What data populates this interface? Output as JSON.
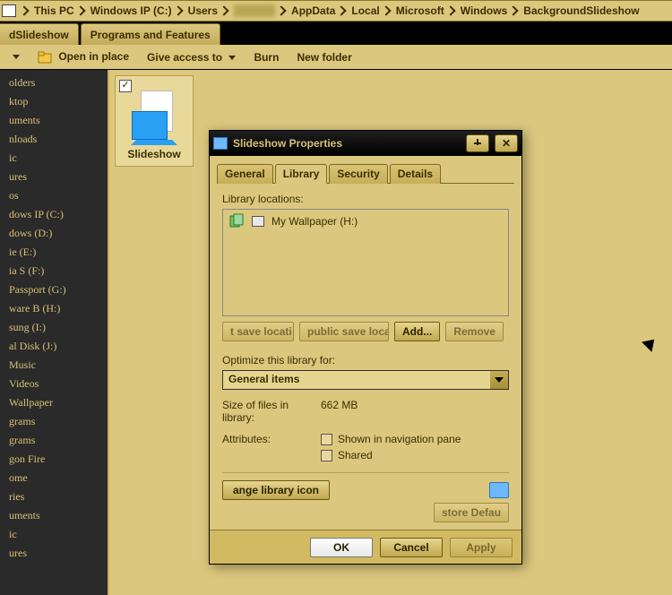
{
  "breadcrumb": [
    "This PC",
    "Windows IP (C:)",
    "Users",
    "",
    "AppData",
    "Local",
    "Microsoft",
    "Windows",
    "BackgroundSlideshow"
  ],
  "file_tabs": {
    "left_partial": "dSlideshow",
    "right": "Programs and Features"
  },
  "toolbar": {
    "open": "Open in place",
    "give_access": "Give access to",
    "burn": "Burn",
    "new_folder": "New folder"
  },
  "sidebar": [
    "olders",
    "ktop",
    "uments",
    "nloads",
    "ic",
    "ures",
    "os",
    "dows IP (C:)",
    "dows (D:)",
    "ie (E:)",
    "ia S (F:)",
    "Passport (G:)",
    "ware B (H:)",
    "sung (I:)",
    "al Disk (J:)",
    "Music",
    "Videos",
    "Wallpaper",
    "grams",
    "grams",
    "gon Fire",
    "ome",
    "ries",
    "uments",
    "ic",
    "ures"
  ],
  "slide_card": {
    "caption": "Slideshow"
  },
  "dialog": {
    "title": "Slideshow Properties",
    "tabs": [
      "General",
      "Library",
      "Security",
      "Details"
    ],
    "active_tab": "Library",
    "locations_label": "Library locations:",
    "locations": [
      {
        "name": "My Wallpaper (H:)"
      }
    ],
    "loc_btns": {
      "set": "t save locati",
      "public": "public save loca",
      "add": "Add...",
      "remove": "Remove"
    },
    "optimize_label": "Optimize this library for:",
    "optimize_value": "General items",
    "size_label": "Size of files in library:",
    "size_value": "662 MB",
    "attributes_label": "Attributes:",
    "attr_nav": "Shown in navigation pane",
    "attr_shared": "Shared",
    "change_icon_btn": "ange library icon",
    "restore_btn": "store Defau",
    "ok": "OK",
    "cancel": "Cancel",
    "apply": "Apply"
  }
}
